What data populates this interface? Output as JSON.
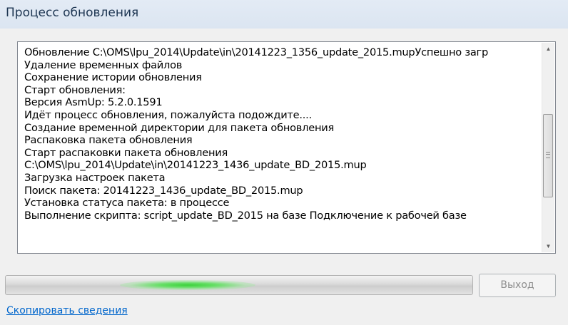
{
  "window": {
    "title": "Процесс обновления"
  },
  "log": {
    "lines": [
      "Обновление C:\\OMS\\lpu_2014\\Update\\in\\20141223_1356_update_2015.mupУспешно загр",
      "Удаление временных файлов",
      "Сохранение истории обновления",
      "Старт обновления:",
      "Версия AsmUp: 5.2.0.1591",
      "Идёт процесс обновления, пожалуйста подождите....",
      "Создание временной директории для пакета обновления",
      "Распаковка пакета обновления",
      "Старт распаковки пакета обновления",
      "C:\\OMS\\lpu_2014\\Update\\in\\20141223_1436_update_BD_2015.mup",
      "Загрузка настроек пакета",
      "Поиск пакета: 20141223_1436_update_BD_2015.mup",
      "Установка статуса пакета: в процессе",
      "Выполнение скрипта: script_update_BD_2015 на базе Подключение к рабочей базе"
    ],
    "scroll_position": 0.58
  },
  "progress": {
    "indeterminate": true,
    "glow_position": 0.39,
    "glow_color": "#3cd13c"
  },
  "actions": {
    "exit_label": "Выход",
    "exit_enabled": false,
    "copy_details_label": "Скопировать сведения"
  },
  "colors": {
    "title_text": "#1e3652",
    "link": "#0066cc",
    "disabled_text": "#8d8d8d"
  }
}
